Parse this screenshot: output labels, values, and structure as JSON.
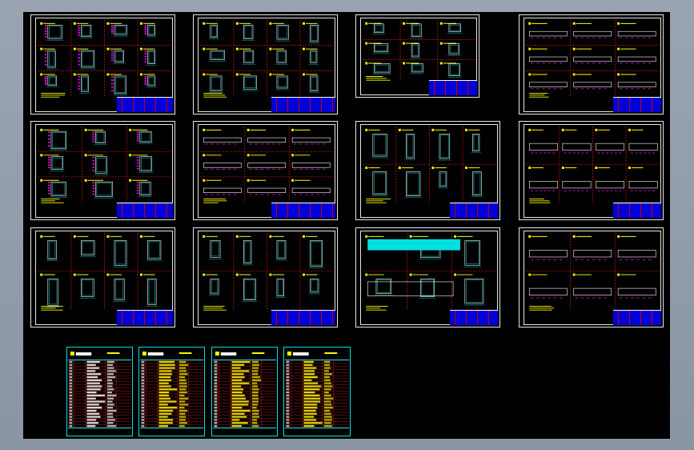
{
  "app": {
    "background_color": "#000000",
    "frame_color": "#9aa4b1"
  },
  "colors": {
    "border": "#e8e8e8",
    "cyan": "#00e0e0",
    "magenta": "#ff00ff",
    "yellow": "#ffff00",
    "red": "#ff2020",
    "blue": "#0000d8",
    "white": "#ffffff"
  },
  "sheets": [
    {
      "id": "sheet-1",
      "style": "elevations"
    },
    {
      "id": "sheet-2",
      "style": "details-grid"
    },
    {
      "id": "sheet-3",
      "style": "sections-sparse"
    },
    {
      "id": "sheet-4",
      "style": "long-profiles"
    },
    {
      "id": "sheet-5",
      "style": "elevations-dense"
    },
    {
      "id": "sheet-6",
      "style": "long-bars"
    },
    {
      "id": "sheet-7",
      "style": "sections-grid"
    },
    {
      "id": "sheet-8",
      "style": "long-profiles-2"
    },
    {
      "id": "sheet-9",
      "style": "columns-grid"
    },
    {
      "id": "sheet-10",
      "style": "sections-sparse-2"
    },
    {
      "id": "sheet-11",
      "style": "cyan-bar"
    },
    {
      "id": "sheet-12",
      "style": "profiles-mixed"
    }
  ],
  "parts_lists": [
    {
      "id": "list-1",
      "text_color": "#ffffff",
      "rows": 22
    },
    {
      "id": "list-2",
      "text_color": "#ffff00",
      "rows": 22
    },
    {
      "id": "list-3",
      "text_color": "#ffff00",
      "rows": 22
    },
    {
      "id": "list-4",
      "text_color": "#ffff00",
      "rows": 22
    }
  ],
  "icons": {
    "sheet_marker": "crosshair-icon"
  }
}
